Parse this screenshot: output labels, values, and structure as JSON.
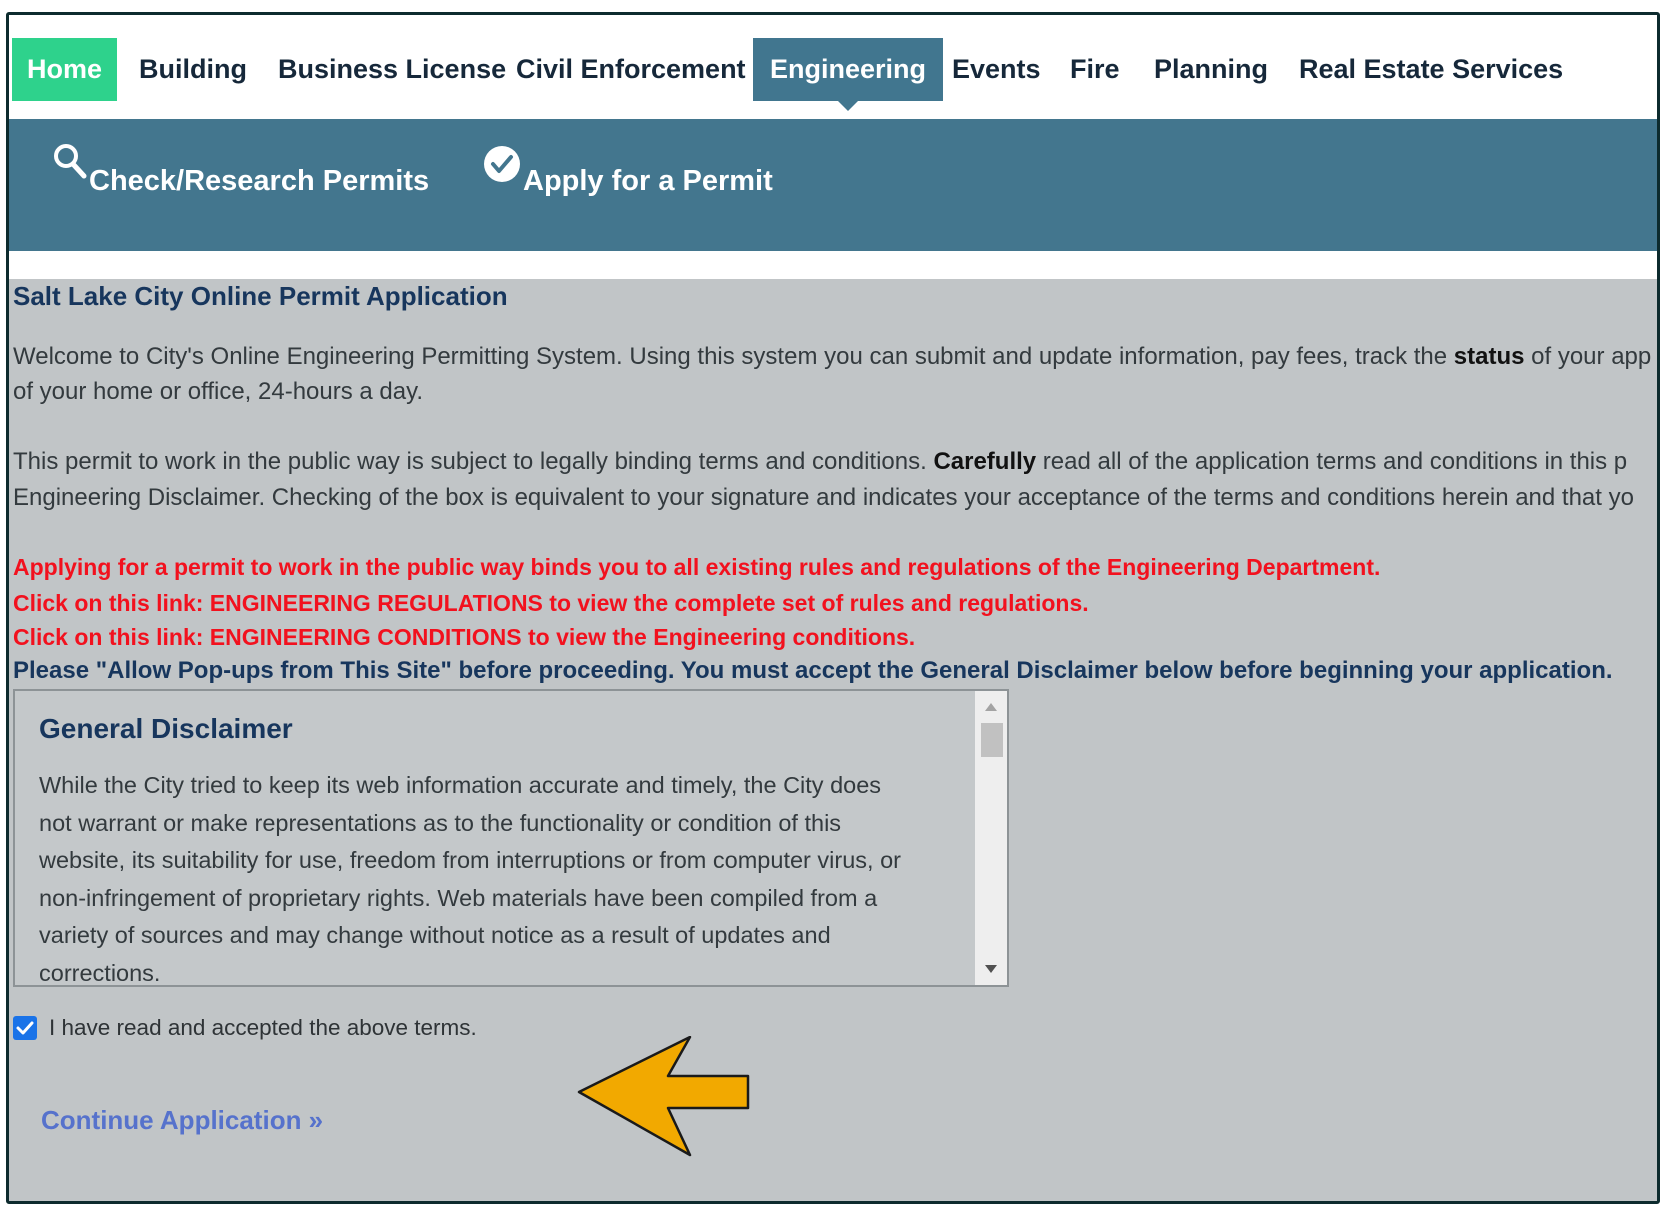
{
  "topnav": {
    "items": [
      "Home",
      "Building",
      "Business License",
      "Civil Enforcement",
      "Engineering",
      "Events",
      "Fire",
      "Planning",
      "Real Estate Services"
    ],
    "active": "Engineering",
    "home_color": "#2ed28c",
    "active_color": "#41768f"
  },
  "subnav": {
    "check_label": "Check/Research Permits",
    "check_icon": "search-icon",
    "apply_label": "Apply for a Permit",
    "apply_icon": "check-circle-icon",
    "background": "#43768e"
  },
  "page": {
    "title": "Salt Lake City Online Permit Application",
    "welcome_line1_pre": "Welcome to City's Online Engineering Permitting System. Using this system you can submit and update information, pay fees, track the ",
    "welcome_status": "status",
    "welcome_line1_post": " of your app",
    "welcome_line2": "of your home or office, 24-hours a day.",
    "terms_line1_pre": "This permit to work in the public way is subject to legally binding terms and conditions. ",
    "terms_carefully": "Carefully",
    "terms_line1_post": " read all of the application terms and conditions in this p",
    "terms_line2": "Engineering Disclaimer. Checking of the box is equivalent to your signature and indicates your acceptance of the terms and conditions herein and that yo",
    "red_line1": "Applying for a permit to work in the public way binds you to all existing rules and regulations of the Engineering Department.",
    "red_line2": "Click on this link: ENGINEERING REGULATIONS to view the complete set of rules and regulations.",
    "red_line3": "Click on this link: ENGINEERING CONDITIONS to view the Engineering conditions.",
    "popup_line": "Please \"Allow Pop-ups from This Site\" before proceeding. You must accept the General Disclaimer below before beginning your application."
  },
  "disclaimer": {
    "title": "General Disclaimer",
    "text": "While the City tried to keep its web information accurate and timely, the City does not warrant or make representations as to the functionality or condition of this website, its suitability for use, freedom from interruptions or from computer virus, or non-infringement of proprietary rights. Web materials have been compiled from a variety of sources and may change without notice as a result of updates and corrections."
  },
  "accept": {
    "label": "I have read and accepted the above terms.",
    "checked": true
  },
  "continue_label": "Continue Application »",
  "annotation": {
    "arrow_color": "#f2a900"
  }
}
